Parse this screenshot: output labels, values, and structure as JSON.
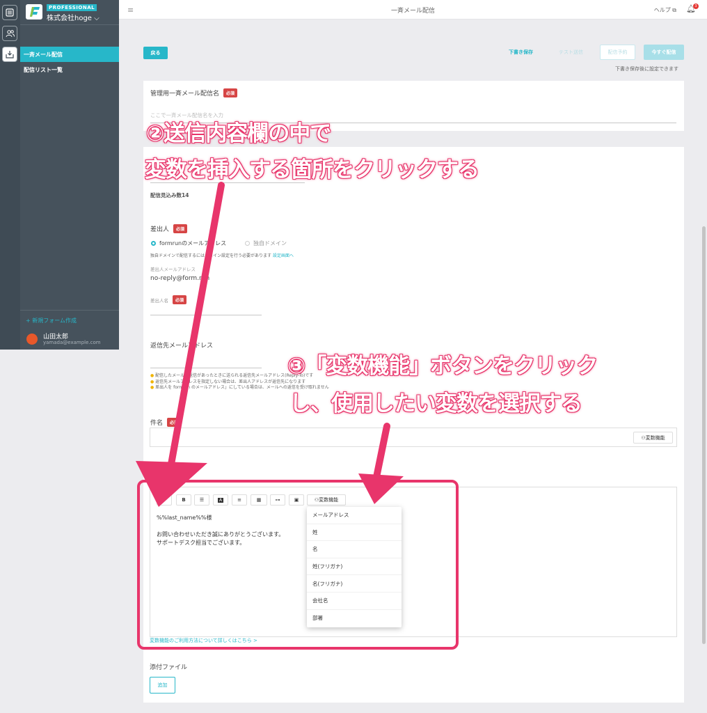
{
  "sidebar": {
    "plan_badge": "PROFESSIONAL",
    "company": "株式会社hoge",
    "nav": [
      {
        "label": "一斉メール配信",
        "active": true
      },
      {
        "label": "配信リスト一覧",
        "active": false
      }
    ],
    "new_form": "+ 新規フォーム作成",
    "user_name": "山田太郎",
    "user_email": "yamada@example.com"
  },
  "header": {
    "title": "一斉メール配信",
    "help": "ヘルプ",
    "notification_count": "3"
  },
  "toolbar": {
    "back": "戻る",
    "save_draft": "下書き保存",
    "test_send": "テスト送信",
    "schedule": "配信予約",
    "send_now": "今すぐ配信",
    "after_save_note": "下書き保存後に設定できます"
  },
  "form": {
    "admin_name_label": "管理用一斉メール配信名",
    "required": "必須",
    "admin_name_placeholder": "ここで一斉メール配信名を入力",
    "estimated_count": "配信見込み数14",
    "sender_label": "差出人",
    "sender_option_formrun": "formrunのメールアドレス",
    "sender_option_own": "独自ドメイン",
    "own_domain_note": "独自ドメインで配信するにはドメイン設定を行う必要があります",
    "own_domain_link": "設定画面へ",
    "sender_email_label": "差出人メールアドレス",
    "sender_email": "no-reply@form.run",
    "sender_name_label": "差出人名",
    "reply_to_label": "返信先メールアドレス",
    "reply_notes": [
      "配信したメールに返信があったときに送られる返信先メールアドレス(Reply-To)です",
      "返信先メールアドレスを指定しない場合は、差出人アドレスが返信先になります",
      "差出人を formrun のメールアドレス」にしている場合は、メールへの返信を受け取れません"
    ],
    "subject_label": "件名",
    "variable_button": "変数機能",
    "body_lines": [
      "%%last_name%%様",
      "",
      "お問い合わせいただき誠にありがとうございます。",
      "サポートデスク担当でございます。"
    ],
    "variable_help_link": "変数機能のご利用方法について詳しくはこちら >",
    "attachment_label": "添付ファイル",
    "add_button": "追加"
  },
  "variable_menu": [
    "メールアドレス",
    "姓",
    "名",
    "姓(フリガナ)",
    "名(フリガナ)",
    "会社名",
    "部署"
  ],
  "annotations": {
    "step2_line1": "②送信内容欄の中で",
    "step2_line2": "変数を挿入する箇所をクリックする",
    "step3_line1": "③「変数機能」ボタンをクリック",
    "step3_line2": "し、使用したい変数を選択する"
  },
  "colors": {
    "accent": "#27b7c9",
    "annotation": "#e8356b",
    "sidebar": "#46525c",
    "required": "#d64545"
  }
}
